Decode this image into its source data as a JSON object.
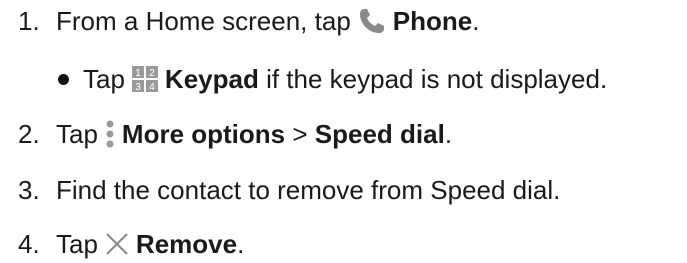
{
  "steps": [
    {
      "number": "1.",
      "pre": "From a Home screen, tap",
      "icon": "phone-icon",
      "bold": "Phone",
      "post": "."
    },
    {
      "bullet_pre": "Tap",
      "icon": "keypad-icon",
      "icon_digits": [
        "1",
        "2",
        "3",
        "4"
      ],
      "bold": "Keypad",
      "post": " if the keypad is not displayed."
    },
    {
      "number": "2.",
      "pre": "Tap",
      "icon": "more-options-icon",
      "bold1": "More options",
      "mid": " > ",
      "bold2": "Speed dial",
      "post": "."
    },
    {
      "number": "3.",
      "text": "Find the contact to remove from Speed dial."
    },
    {
      "number": "4.",
      "pre": "Tap",
      "icon": "remove-x-icon",
      "bold": "Remove",
      "post": "."
    }
  ],
  "colors": {
    "text": "#1a1a1a",
    "phone_icon": "#8a8a8a",
    "keypad_icon": "#9a9a9a",
    "more_icon": "#9a9a9a",
    "remove_icon": "#8a8a8a"
  }
}
